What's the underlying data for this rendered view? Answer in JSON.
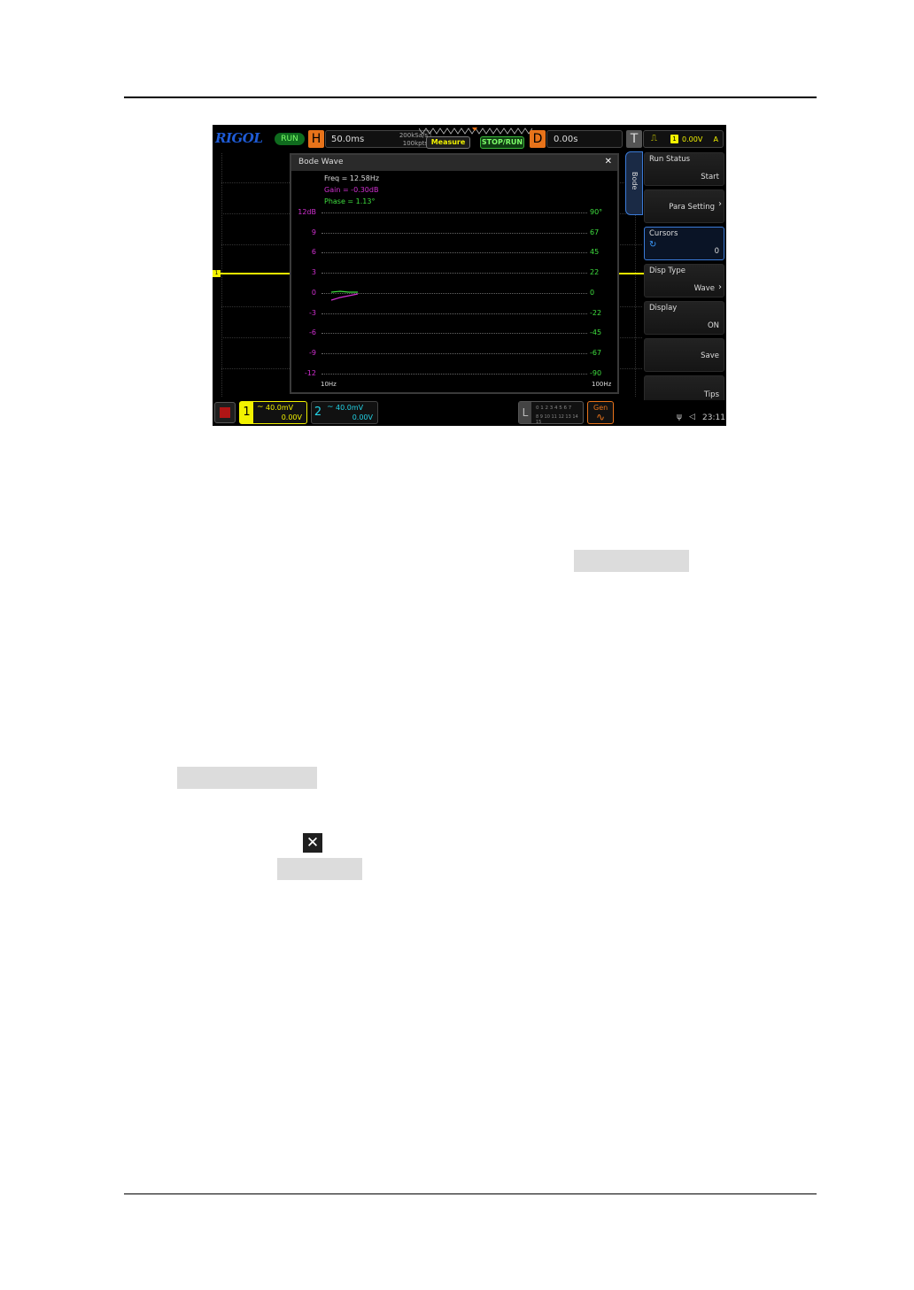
{
  "scope": {
    "logo": "RIGOL",
    "run_status_pill": "RUN",
    "horizontal": {
      "letter": "H",
      "value": "50.0ms",
      "sample_rate": "200kSa/s",
      "points": "100kpts"
    },
    "buttons": {
      "measure": "Measure",
      "stop_run": "STOP/RUN"
    },
    "delay": {
      "letter": "D",
      "value": "0.00s"
    },
    "trigger": {
      "letter": "T",
      "channel": "1",
      "level": "0.00V",
      "mode": "A"
    },
    "side_tab": "Bode",
    "menu": [
      {
        "title": "Run Status",
        "value": "Start"
      },
      {
        "title": "",
        "value": "Para Setting"
      },
      {
        "title": "Cursors",
        "value": "0"
      },
      {
        "title": "Disp Type",
        "value": "Wave"
      },
      {
        "title": "Display",
        "value": "ON"
      },
      {
        "title": "",
        "value": "Save"
      },
      {
        "title": "",
        "value": "Tips"
      }
    ],
    "trigger_marker": "1",
    "bode": {
      "title": "Bode Wave",
      "close": "✕",
      "freq": "Freq = 12.58Hz",
      "gain": "Gain = -0.30dB",
      "phase": "Phase = 1.13°",
      "gain_ticks": [
        "12dB",
        "9",
        "6",
        "3",
        "0",
        "-3",
        "-6",
        "-9",
        "-12"
      ],
      "phase_ticks": [
        "90°",
        "67",
        "45",
        "22",
        "0",
        "-22",
        "-45",
        "-67",
        "-90"
      ],
      "x_start": "10Hz",
      "x_end": "100Hz",
      "colors": {
        "gain": "#d02fd0",
        "phase": "#3fdf3f"
      }
    },
    "channels": [
      {
        "num": "1",
        "scale": "40.0mV",
        "offset": "0.00V",
        "color": "#f2f200"
      },
      {
        "num": "2",
        "scale": "40.0mV",
        "offset": "0.00V",
        "color": "#22d3e6"
      }
    ],
    "logic": {
      "letter": "L",
      "row1": "0 1 2 3  4 5 6 7",
      "row2": "8 9 10 11 12 13 14 15"
    },
    "gen": "Gen",
    "clock": "23:11"
  }
}
